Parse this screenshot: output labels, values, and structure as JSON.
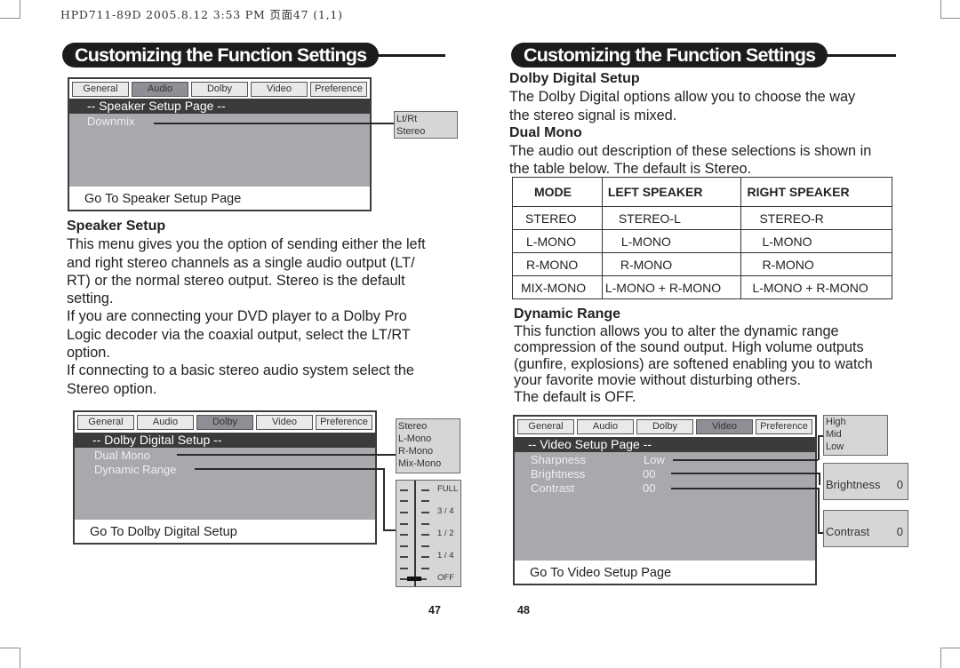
{
  "print_header": "HPD711-89D  2005.8.12  3:53 PM  页面47 (1,1)",
  "left_page": {
    "banner": "Customizing the Function Settings",
    "speaker_osd": {
      "tabs": [
        "General",
        "Audio",
        "Dolby",
        "Video",
        "Preference"
      ],
      "active_tab": "Audio",
      "title": "-- Speaker Setup Page --",
      "options": [
        "Downmix"
      ],
      "footer": "Go To Speaker Setup Page",
      "popup_options": [
        "Lt/Rt",
        "Stereo"
      ]
    },
    "speaker_setup": {
      "heading": "Speaker Setup",
      "lines": [
        "This menu gives you the option of sending either the left",
        "and right stereo channels as a single audio output (LT/",
        "RT) or the normal stereo output. Stereo is the default",
        "setting.",
        "If you are connecting your DVD player to a Dolby Pro",
        "Logic decoder via the coaxial output, select the LT/RT",
        "option.",
        "If connecting to a basic stereo audio system select the",
        "Stereo option."
      ]
    },
    "dolby_osd": {
      "tabs": [
        "General",
        "Audio",
        "Dolby",
        "Video",
        "Preference"
      ],
      "active_tab": "Dolby",
      "title": "-- Dolby Digital Setup --",
      "options": [
        "Dual Mono",
        "Dynamic Range"
      ],
      "footer": "Go To Dolby Digital Setup",
      "dual_mono_options": [
        "Stereo",
        "L-Mono",
        "R-Mono",
        "Mix-Mono"
      ],
      "dynamic_range_scale": [
        "FULL",
        "3 / 4",
        "1 / 2",
        "1 / 4",
        "OFF"
      ],
      "dynamic_range_value": "OFF"
    },
    "page_number": "47"
  },
  "right_page": {
    "banner": "Customizing the Function Settings",
    "dolby_digital": {
      "heading": "Dolby Digital Setup",
      "lines": [
        "The Dolby Digital options allow you to choose the way",
        "the stereo signal is mixed."
      ]
    },
    "dual_mono": {
      "heading": "Dual Mono",
      "lines": [
        "The audio out description of these selections is shown in",
        "the table below. The default is Stereo."
      ]
    },
    "mode_table": {
      "headers": [
        "MODE",
        "LEFT SPEAKER",
        "RIGHT SPEAKER"
      ],
      "rows": [
        [
          "STEREO",
          "STEREO-L",
          "STEREO-R"
        ],
        [
          "L-MONO",
          "L-MONO",
          "L-MONO"
        ],
        [
          "R-MONO",
          "R-MONO",
          "R-MONO"
        ],
        [
          "MIX-MONO",
          "L-MONO + R-MONO",
          "L-MONO + R-MONO"
        ]
      ]
    },
    "dynamic_range": {
      "heading": "Dynamic Range",
      "lines": [
        "This function allows you to alter the dynamic range",
        "compression of the sound output. High volume outputs",
        "(gunfire, explosions) are softened enabling you to watch",
        "your favorite movie without disturbing others.",
        "The default is OFF."
      ]
    },
    "video_osd": {
      "tabs": [
        "General",
        "Audio",
        "Dolby",
        "Video",
        "Preference"
      ],
      "active_tab": "Video",
      "title": "-- Video Setup Page --",
      "options": [
        {
          "label": "Sharpness",
          "value": "Low"
        },
        {
          "label": "Brightness",
          "value": "00"
        },
        {
          "label": "Contrast",
          "value": "00"
        }
      ],
      "footer": "Go To Video Setup Page",
      "sharpness_options": [
        "High",
        "Mid",
        "Low"
      ],
      "brightness_popup": {
        "label": "Brightness",
        "value": "0"
      },
      "contrast_popup": {
        "label": "Contrast",
        "value": "0"
      }
    },
    "page_number": "48"
  }
}
